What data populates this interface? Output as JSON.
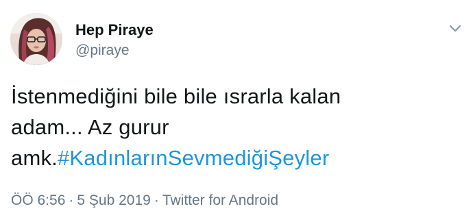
{
  "user": {
    "display_name": "Hep Piraye",
    "handle": "@piraye"
  },
  "icons": {
    "menu": "chevron-down-icon"
  },
  "tweet": {
    "line1": "İstenmediğini bile bile ısrarla kalan",
    "line2": "adam... Az gurur",
    "line3_text": "amk.",
    "hashtag": "#KadınlarınSevmediğiŞeyler"
  },
  "meta": {
    "time": "ÖÖ 6:56",
    "separator": "·",
    "date": "5 Şub 2019",
    "source": "Twitter for Android"
  },
  "colors": {
    "link": "#1b95e0",
    "secondary_text": "#657786",
    "primary_text": "#14171a"
  }
}
